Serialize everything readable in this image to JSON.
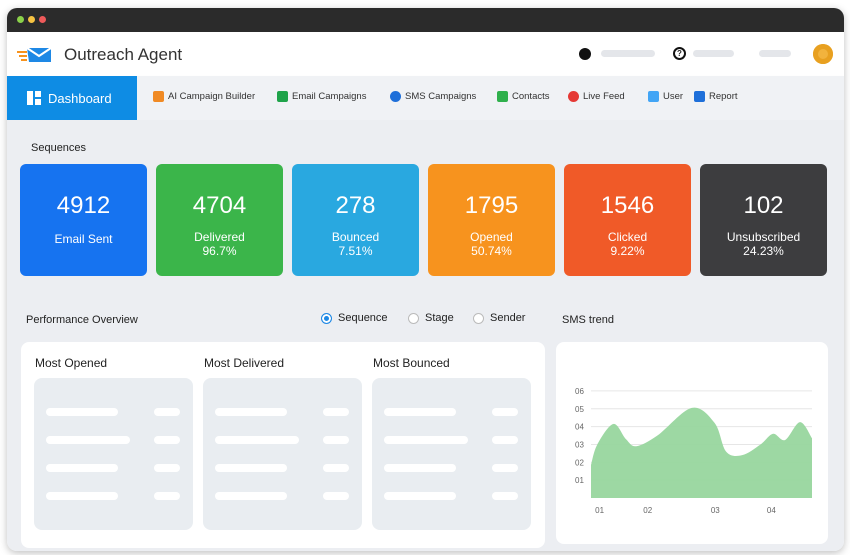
{
  "app": {
    "title": "Outreach Agent"
  },
  "nav": {
    "dashboard": "Dashboard",
    "items": [
      {
        "label": "AI Campaign Builder",
        "icon": "rocket-icon",
        "color": "#f08a24"
      },
      {
        "label": "Email Campaigns",
        "icon": "email-icon",
        "color": "#1fa34a"
      },
      {
        "label": "SMS Campaigns",
        "icon": "chat-icon",
        "color": "#1e6fd9"
      },
      {
        "label": "Contacts",
        "icon": "contacts-icon",
        "color": "#2fb04c"
      },
      {
        "label": "Live Feed",
        "icon": "broadcast-icon",
        "color": "#e53935"
      },
      {
        "label": "User",
        "icon": "user-icon",
        "color": "#42a5f5"
      },
      {
        "label": "Report",
        "icon": "report-icon",
        "color": "#1e6fd9"
      }
    ]
  },
  "sequences": {
    "title": "Sequences",
    "cards": [
      {
        "value": "4912",
        "label": "Email Sent",
        "pct": "",
        "color": "#1673f0"
      },
      {
        "value": "4704",
        "label": "Delivered",
        "pct": "96.7%",
        "color": "#3bb54a"
      },
      {
        "value": "278",
        "label": "Bounced",
        "pct": "7.51%",
        "color": "#29a8e0"
      },
      {
        "value": "1795",
        "label": "Opened",
        "pct": "50.74%",
        "color": "#f7931e"
      },
      {
        "value": "1546",
        "label": "Clicked",
        "pct": "9.22%",
        "color": "#f05a28"
      },
      {
        "value": "102",
        "label": "Unsubscribed",
        "pct": "24.23%",
        "color": "#3d3d3f"
      }
    ]
  },
  "performance": {
    "title": "Performance Overview",
    "options": [
      "Sequence",
      "Stage",
      "Sender"
    ],
    "selected": "Sequence",
    "columns": [
      "Most Opened",
      "Most Delivered",
      "Most Bounced"
    ]
  },
  "chart_data": {
    "type": "area",
    "title": "SMS trend",
    "color": "#98d69e",
    "yticks": [
      "01",
      "02",
      "03",
      "04",
      "05",
      "06"
    ],
    "ylim": [
      0,
      6.5
    ],
    "xticks": [
      {
        "x": 1,
        "label": "01"
      },
      {
        "x": 1.84,
        "label": "02"
      },
      {
        "x": 3.02,
        "label": "03"
      },
      {
        "x": 4,
        "label": "04"
      }
    ],
    "xlim": [
      0.84,
      4.7
    ],
    "x": [
      0.84,
      0.95,
      1.23,
      1.45,
      1.63,
      2.0,
      2.6,
      3.0,
      3.2,
      3.48,
      3.8,
      4.02,
      4.23,
      4.49,
      4.7
    ],
    "y": [
      1.85,
      3.0,
      4.15,
      3.3,
      2.9,
      3.5,
      5.05,
      4.2,
      2.6,
      2.4,
      3.0,
      3.6,
      3.25,
      4.25,
      3.35
    ],
    "grid": true
  }
}
